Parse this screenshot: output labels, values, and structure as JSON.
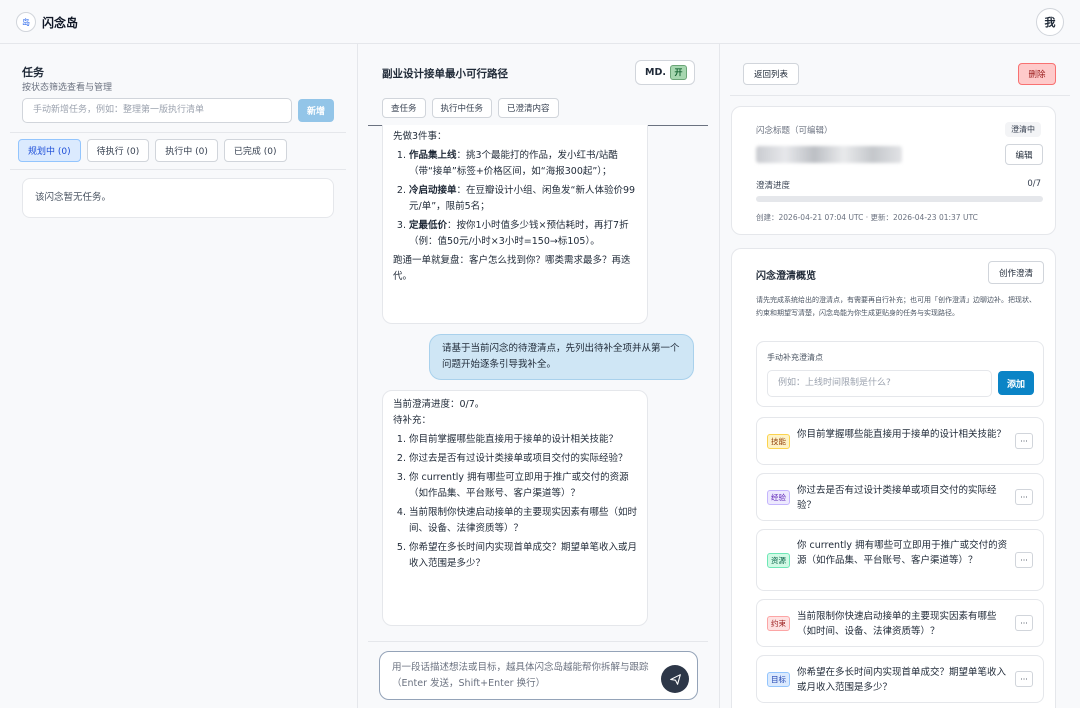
{
  "app": {
    "logo_text": "岛",
    "title": "闪念岛",
    "user_button": "我"
  },
  "tasks": {
    "title": "任务",
    "subtitle": "按状态筛选查看与管理",
    "input_placeholder": "手动新增任务，例如：整理第一版执行清单",
    "new_button": "新增",
    "filters": [
      "规划中 (0)",
      "待执行 (0)",
      "执行中 (0)",
      "已完成 (0)"
    ],
    "active_filter": 0,
    "empty_text": "该闪念暂无任务。"
  },
  "chat": {
    "title": "副业设计接单最小可行路径",
    "md_label": "MD.",
    "md_toggle_state": "开",
    "tabs": [
      "查任务",
      "执行中任务",
      "已澄清内容"
    ],
    "msg1": {
      "intro": "先做3件事：",
      "items": [
        {
          "bold": "作品集上线",
          "text": "：挑3个最能打的作品，发小红书/站酷（带“接单”标签+价格区间，如“海报300起”）；"
        },
        {
          "bold": "冷启动接单",
          "text": "：在豆瓣设计小组、闲鱼发“新人体验价99元/单”，限前5名；"
        },
        {
          "bold": "定最低价",
          "text": "：按你1小时值多少钱×预估耗时，再打7折（例：值50元/小时×3小时=150→标105）。"
        }
      ],
      "outro": "跑通一单就复盘：客户怎么找到你？哪类需求最多？再迭代。"
    },
    "user_msg": "请基于当前闪念的待澄清点，先列出待补全项并从第一个问题开始逐条引导我补全。",
    "msg2": {
      "line1": "当前澄清进度：0/7。",
      "line2": "待补充：",
      "items": [
        "你目前掌握哪些能直接用于接单的设计相关技能？",
        "你过去是否有过设计类接单或项目交付的实际经验？",
        "你 currently 拥有哪些可立即用于推广或交付的资源（如作品集、平台账号、客户渠道等）？",
        "当前限制你快速启动接单的主要现实因素有哪些（如时间、设备、法律资质等）？",
        "你希望在多长时间内实现首单成交？期望单笔收入或月收入范围是多少？"
      ]
    },
    "composer_placeholder": "用一段话描述想法或目标，越具体闪念岛越能帮你拆解与跟踪（Enter 发送，Shift+Enter 换行）"
  },
  "detail": {
    "back_button": "返回列表",
    "delete_button": "删除",
    "title_label": "闪念标题（可编辑）",
    "status_badge": "澄清中",
    "edit_button": "编辑",
    "progress_label": "澄清进度",
    "progress_text": "0/7",
    "progress_fraction": 0,
    "timestamps": "创建：2026-04-21 07:04 UTC · 更新：2026-04-23 01:37 UTC",
    "overview_title": "闪念澄清概览",
    "create_button": "创作澄清",
    "overview_desc": "请先完成系统给出的澄清点，有需要再自行补充；也可用「创作澄清」边聊边补。把现状、约束和期望写清楚，闪念岛能为你生成更贴身的任务与实现路径。",
    "manual_label": "手动补充澄清点",
    "manual_placeholder": "例如：上线时间限制是什么?",
    "add_button": "添加",
    "more_label": "···",
    "items": [
      {
        "tag": "技能",
        "text": "你目前掌握哪些能直接用于接单的设计相关技能？"
      },
      {
        "tag": "经验",
        "text": "你过去是否有过设计类接单或项目交付的实际经验？"
      },
      {
        "tag": "资源",
        "text": "你 currently 拥有哪些可立即用于推广或交付的资源（如作品集、平台账号、客户渠道等）？"
      },
      {
        "tag": "约束",
        "text": "当前限制你快速启动接单的主要现实因素有哪些（如时间、设备、法律资质等）？"
      },
      {
        "tag": "目标",
        "text": "你希望在多长时间内实现首单成交？期望单笔收入或月收入范围是多少？"
      }
    ]
  }
}
